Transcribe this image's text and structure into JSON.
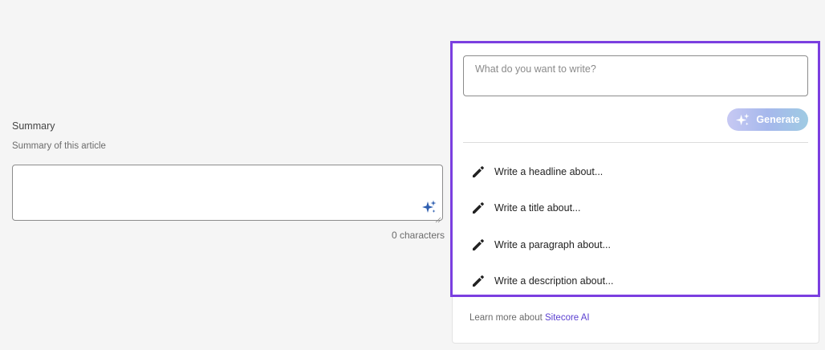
{
  "summary_field": {
    "label": "Summary",
    "hint": "Summary of this article",
    "value": "",
    "char_count_text": "0 characters",
    "ai_icon": "sparkles-icon"
  },
  "ai_panel": {
    "prompt_placeholder": "What do you want to write?",
    "generate_label": "Generate",
    "generate_icon": "sparkles-icon",
    "accent_color": "#7b3fe0",
    "suggestions": [
      {
        "label": "Write a headline about...",
        "icon": "pencil-icon"
      },
      {
        "label": "Write a title about...",
        "icon": "pencil-icon"
      },
      {
        "label": "Write a paragraph about...",
        "icon": "pencil-icon"
      },
      {
        "label": "Write a description about...",
        "icon": "pencil-icon"
      }
    ],
    "footer": {
      "prefix": "Learn more about",
      "link_text": "Sitecore AI",
      "link_color": "#5a3fd0"
    }
  }
}
